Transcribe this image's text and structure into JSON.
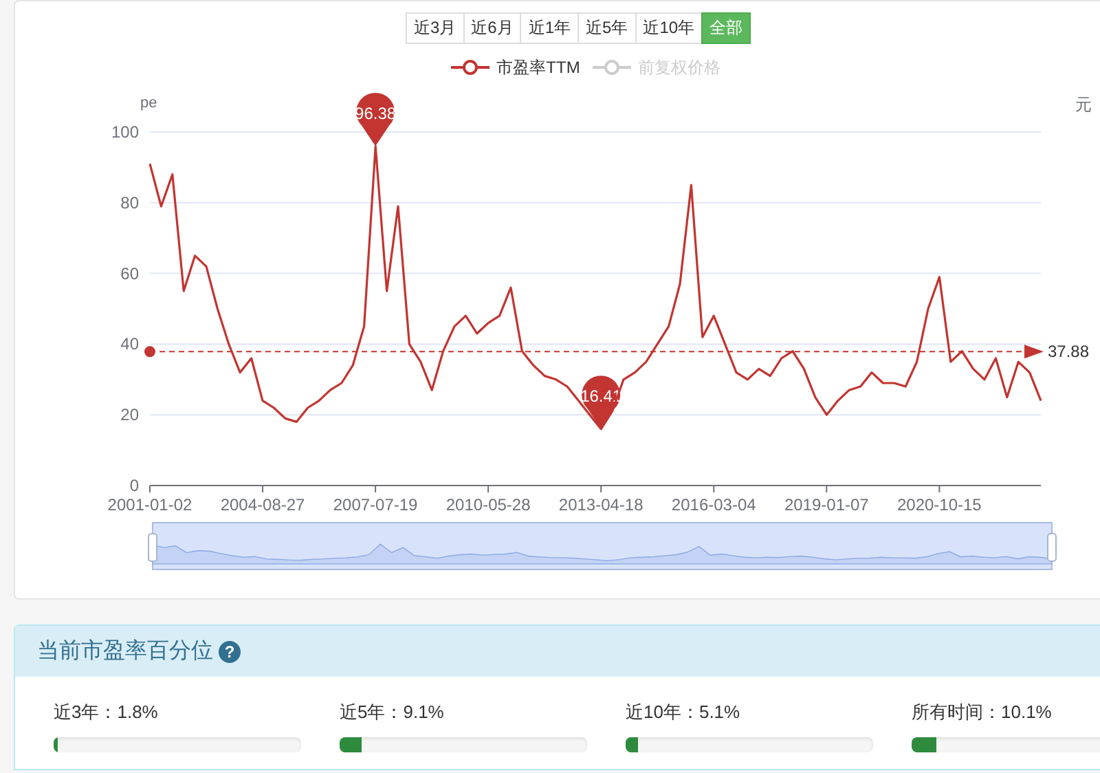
{
  "range_buttons": [
    {
      "label": "近3月",
      "selected": false
    },
    {
      "label": "近6月",
      "selected": false
    },
    {
      "label": "近1年",
      "selected": false
    },
    {
      "label": "近5年",
      "selected": false
    },
    {
      "label": "近10年",
      "selected": false
    },
    {
      "label": "全部",
      "selected": true
    }
  ],
  "legend": [
    {
      "label": "市盈率TTM",
      "selected": true
    },
    {
      "label": "前复权价格",
      "selected": false
    }
  ],
  "chart": {
    "right_axis_label": "元",
    "chart_data": {
      "type": "line",
      "ylabel": "pe",
      "categories": [
        "2001-01-02",
        null,
        null,
        null,
        null,
        null,
        null,
        null,
        null,
        null,
        "2004-08-27",
        null,
        null,
        null,
        null,
        null,
        null,
        null,
        null,
        null,
        "2007-07-19",
        null,
        null,
        null,
        null,
        null,
        null,
        null,
        null,
        null,
        "2010-05-28",
        null,
        null,
        null,
        null,
        null,
        null,
        null,
        null,
        null,
        "2013-04-18",
        null,
        null,
        null,
        null,
        null,
        null,
        null,
        null,
        null,
        "2016-03-04",
        null,
        null,
        null,
        null,
        null,
        null,
        null,
        null,
        null,
        "2019-01-07",
        null,
        null,
        null,
        null,
        null,
        null,
        null,
        null,
        null,
        "2020-10-15",
        null,
        null,
        null,
        null,
        null,
        null,
        null,
        null,
        null
      ],
      "ylim": [
        0,
        100
      ],
      "yticks": [
        0,
        20,
        40,
        60,
        80,
        100
      ],
      "grid": true,
      "series": [
        {
          "color": "#c23531",
          "values": [
            91,
            79,
            88,
            55,
            65,
            62,
            50,
            40,
            32,
            36,
            24,
            22,
            19,
            18,
            22,
            24,
            27,
            29,
            34,
            45,
            96,
            55,
            79,
            40,
            35,
            27,
            38,
            45,
            48,
            43,
            46,
            48,
            56,
            38,
            34,
            31,
            30,
            28,
            24,
            20,
            16,
            21,
            30,
            32,
            35,
            40,
            45,
            57,
            85,
            42,
            48,
            40,
            32,
            30,
            33,
            31,
            36,
            38,
            33,
            25,
            20,
            24,
            27,
            28,
            32,
            29,
            29,
            28,
            35,
            50,
            59,
            35,
            38,
            33,
            30,
            36,
            25,
            35,
            32,
            24
          ]
        }
      ],
      "annotations": [
        {
          "text": "96.38",
          "x": "2007-07-19",
          "y": 96
        },
        {
          "text": "16.41",
          "x": "2013-04-18",
          "y": 16
        }
      ],
      "ref_lines": [
        {
          "axis": "y",
          "value": 37.88,
          "label": "37.88"
        }
      ]
    }
  },
  "percentile": {
    "title": "当前市盈率百分位",
    "help_icon": "?",
    "items": [
      {
        "text": "近3年：1.8%",
        "level": 0.018
      },
      {
        "text": "近5年：9.1%",
        "level": 0.091
      },
      {
        "text": "近10年：5.1%",
        "level": 0.051
      },
      {
        "text": "所有时间：10.1%",
        "level": 0.101
      }
    ]
  }
}
